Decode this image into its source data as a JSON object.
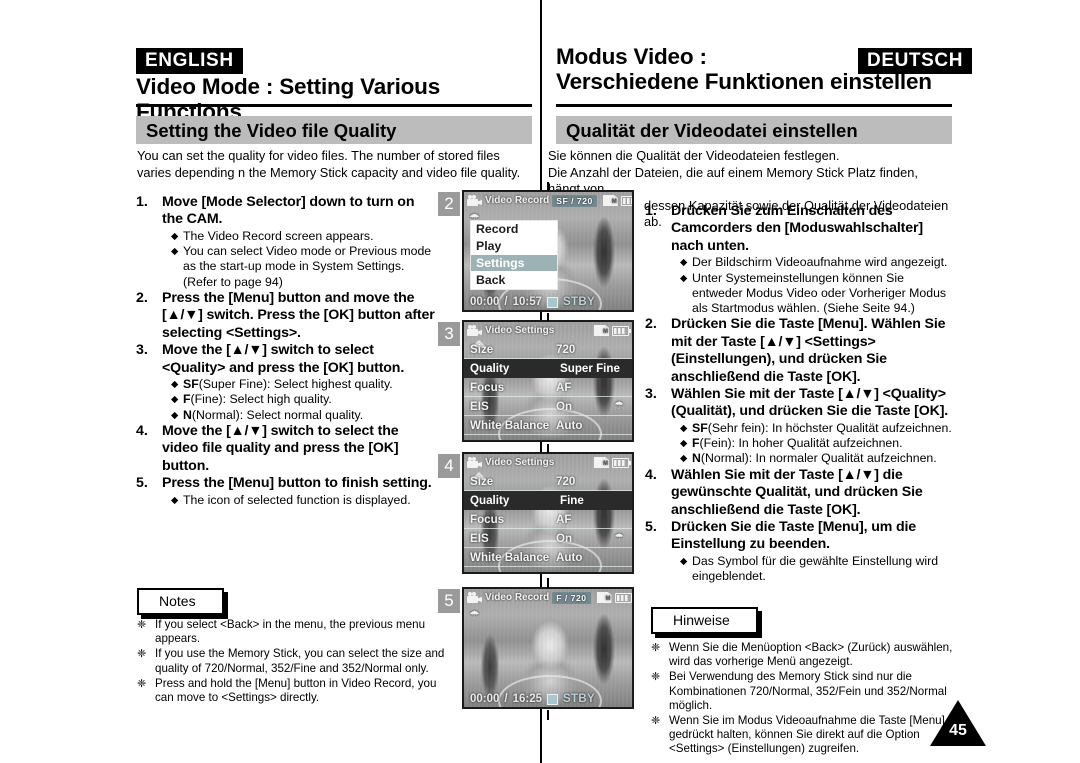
{
  "page_number": "45",
  "divider_color": "#000000",
  "english": {
    "lang_tag": "ENGLISH",
    "chapter_title": "Video Mode : Setting Various Functions",
    "section_title": "Setting the Video file Quality",
    "intro": "You can set the quality for video files. The number of stored files varies depending n the Memory Stick capacity and video file quality.",
    "steps": [
      {
        "num": "1.",
        "text": "Move [Mode Selector] down to turn on the CAM.",
        "bullets": [
          "The Video Record screen appears.",
          "You can select Video mode or Previous mode as the start-up mode in System Settings. (Refer to page 94)"
        ]
      },
      {
        "num": "2.",
        "text": "Press the [Menu] button and move the [▲/▼] switch. Press the [OK] button after selecting <Settings>.",
        "bullets": []
      },
      {
        "num": "3.",
        "text": "Move the [▲/▼] switch to select <Quality> and press the [OK] button.",
        "bullets": [
          "SF(Super Fine): Select highest quality.",
          "F(Fine): Select high quality.",
          "N(Normal): Select normal quality."
        ]
      },
      {
        "num": "4.",
        "text": "Move the [▲/▼] switch to select the video file quality and press the [OK] button.",
        "bullets": []
      },
      {
        "num": "5.",
        "text": "Press the [Menu] button to finish setting.",
        "bullets": [
          "The icon of selected function is displayed."
        ]
      }
    ],
    "notes_label": "Notes",
    "notes": [
      "If you select <Back> in the menu, the previous menu appears.",
      "If you use the Memory Stick, you can select the size and quality of 720/Normal, 352/Fine and 352/Normal only.",
      "Press and hold the [Menu] button in Video Record, you can move to <Settings> directly."
    ]
  },
  "german": {
    "lang_tag": "DEUTSCH",
    "chapter_title_line1": "Modus Video :",
    "chapter_title_line2": "Verschiedene Funktionen einstellen",
    "section_title": "Qualität der Videodatei einstellen",
    "intro_line1": "Sie können die Qualität der Videodateien festlegen.",
    "intro_line2": "Die Anzahl der Dateien, die auf einem Memory Stick Platz finden, hängt von",
    "intro_line3": "dessen Kapazität sowie der Qualität der Videodateien ab.",
    "steps": [
      {
        "num": "1.",
        "text": "Drücken Sie zum Einschalten des Camcorders den [Moduswahlschalter] nach unten.",
        "bullets": [
          "Der Bildschirm Videoaufnahme wird angezeigt.",
          "Unter Systemeinstellungen können Sie entweder Modus Video oder Vorheriger Modus als Startmodus wählen. (Siehe Seite 94.)"
        ]
      },
      {
        "num": "2.",
        "text": "Drücken Sie die Taste [Menu]. Wählen Sie mit der Taste [▲/▼] <Settings> (Einstellungen), und drücken Sie anschließend die Taste [OK].",
        "bullets": []
      },
      {
        "num": "3.",
        "text": "Wählen Sie mit der Taste [▲/▼] <Quality> (Qualität), und drücken Sie die Taste [OK].",
        "bullets": [
          "SF(Sehr fein): In höchster Qualität aufzeichnen.",
          "F(Fein): In hoher Qualität aufzeichnen.",
          "N(Normal): In normaler Qualität aufzeichnen."
        ]
      },
      {
        "num": "4.",
        "text": "Wählen Sie mit der Taste [▲/▼]  die gewünschte Qualität, und drücken Sie anschließend die Taste [OK].",
        "bullets": []
      },
      {
        "num": "5.",
        "text": "Drücken Sie die Taste [Menu], um die Einstellung zu beenden.",
        "bullets": [
          "Das Symbol für die gewählte Einstellung wird eingeblendet."
        ]
      }
    ],
    "notes_label": "Hinweise",
    "notes": [
      "Wenn Sie die Menüoption <Back> (Zurück) auswählen, wird das vorherige Menü angezeigt.",
      "Bei Verwendung des Memory Stick sind nur die Kombinationen 720/Normal, 352/Fein und 352/Normal möglich.",
      "Wenn Sie im Modus Videoaufnahme die Taste [Menu] gedrückt halten, können Sie direkt auf die Option <Settings> (Einstellungen) zugreifen."
    ]
  },
  "screens": [
    {
      "badge": "2",
      "title": "Video Record",
      "quality_badge": "SF  /  720",
      "menu_items": [
        {
          "label": "Record",
          "selected": false
        },
        {
          "label": "Play",
          "selected": false
        },
        {
          "label": "Settings",
          "selected": true
        },
        {
          "label": "Back",
          "selected": false
        }
      ],
      "time_elapsed": "00:00",
      "time_total": "10:57",
      "status": "STBY"
    },
    {
      "badge": "3",
      "title": "Video Settings",
      "rows": [
        {
          "label": "Size",
          "value": "720",
          "active": false
        },
        {
          "label": "Quality",
          "value": "Super Fine",
          "active": true
        },
        {
          "label": "Focus",
          "value": "AF",
          "active": false
        },
        {
          "label": "EIS",
          "value": "On",
          "active": false
        },
        {
          "label": "White Balance",
          "value": "Auto",
          "active": false
        }
      ]
    },
    {
      "badge": "4",
      "title": "Video Settings",
      "rows": [
        {
          "label": "Size",
          "value": "720",
          "active": false
        },
        {
          "label": "Quality",
          "value": "Fine",
          "active": true
        },
        {
          "label": "Focus",
          "value": "AF",
          "active": false
        },
        {
          "label": "EIS",
          "value": "On",
          "active": false
        },
        {
          "label": "White Balance",
          "value": "Auto",
          "active": false
        }
      ]
    },
    {
      "badge": "5",
      "title": "Video Record",
      "quality_badge": "F  /  720",
      "time_elapsed": "00:00",
      "time_total": "16:25",
      "status": "STBY"
    }
  ]
}
